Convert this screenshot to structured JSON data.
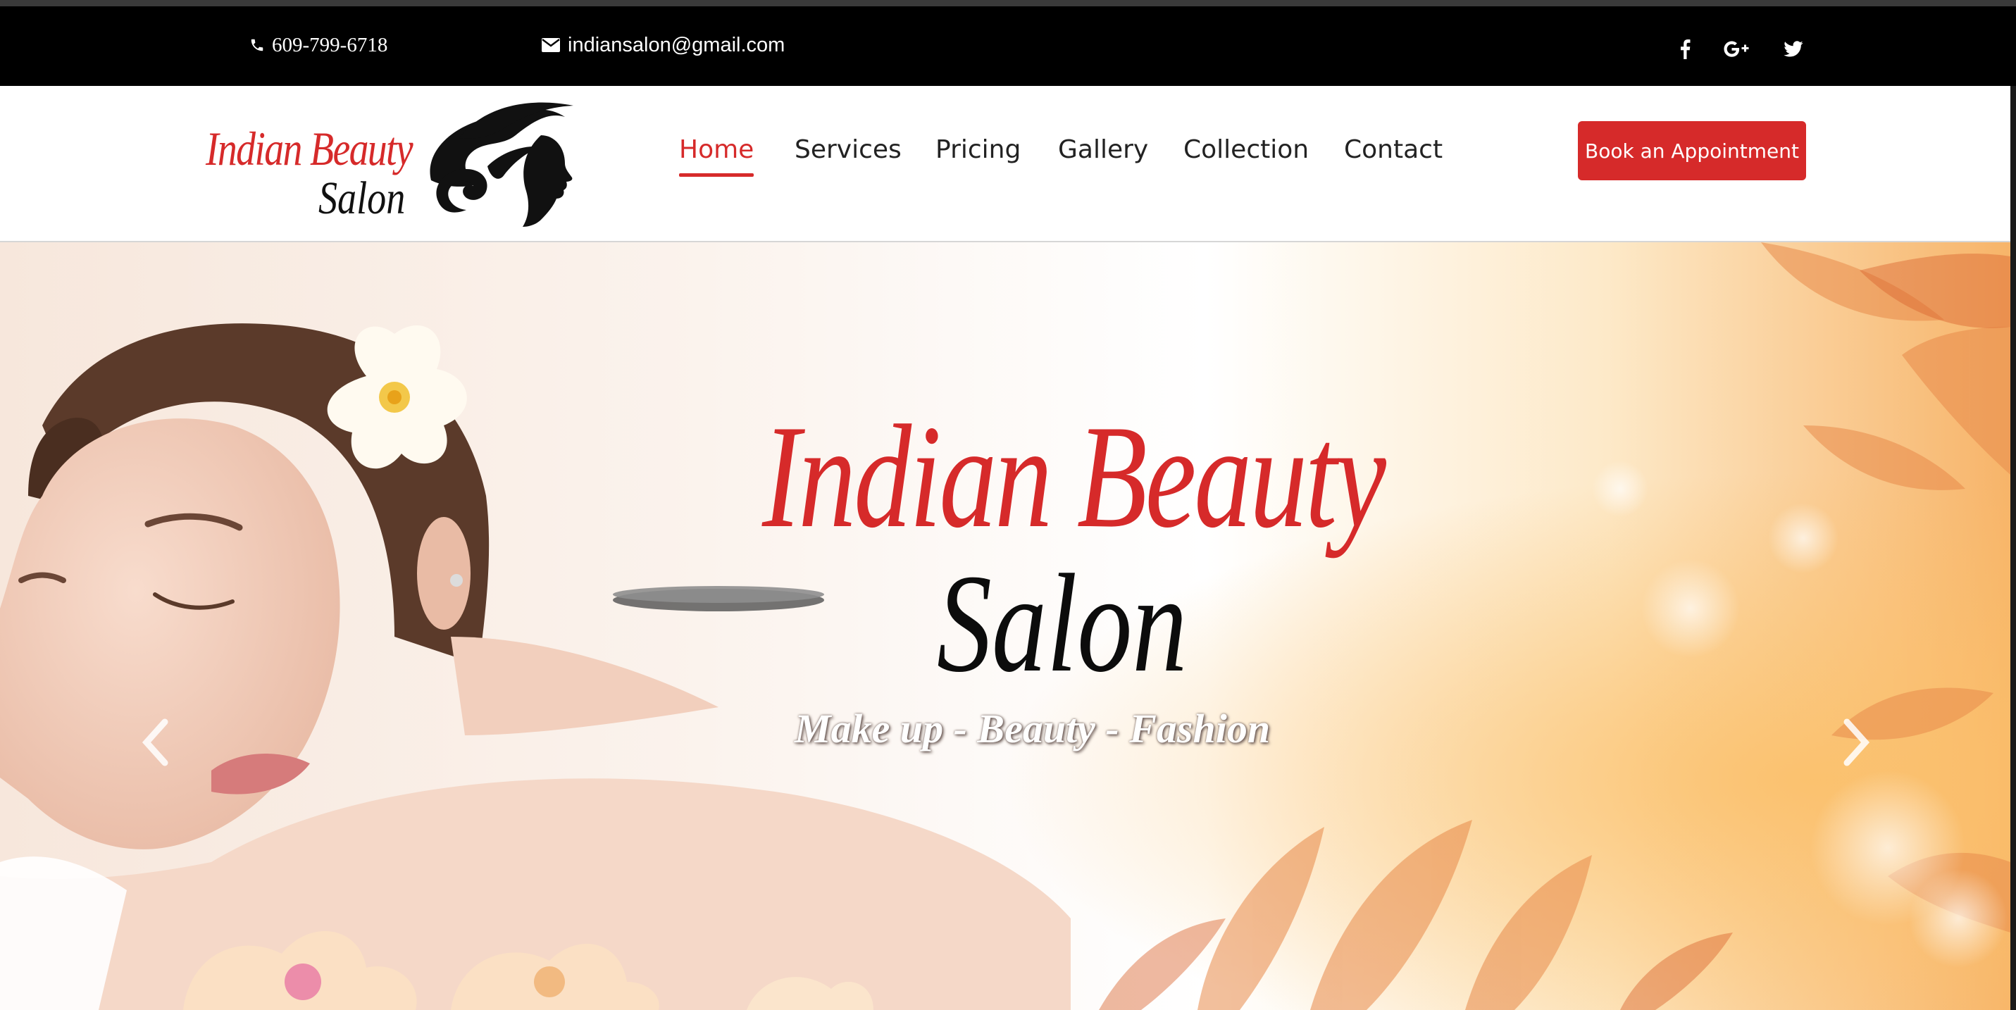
{
  "topbar": {
    "phone": "609-799-6718",
    "email": "indiansalon@gmail.com",
    "phone_icon": "phone-icon",
    "email_icon": "envelope-icon",
    "social": [
      {
        "name": "facebook-icon",
        "glyph": "f"
      },
      {
        "name": "google-plus-icon",
        "glyph": "G+"
      },
      {
        "name": "twitter-icon",
        "glyph": "twitter"
      }
    ]
  },
  "logo": {
    "line1": "Indian Beauty",
    "line2": "Salon"
  },
  "nav": {
    "items": [
      {
        "label": "Home",
        "active": true
      },
      {
        "label": "Services",
        "active": false
      },
      {
        "label": "Pricing",
        "active": false
      },
      {
        "label": "Gallery",
        "active": false
      },
      {
        "label": "Collection",
        "active": false
      },
      {
        "label": "Contact",
        "active": false
      }
    ]
  },
  "cta": {
    "label": "Book an Appointment"
  },
  "hero": {
    "title_line1": "Indian Beauty",
    "title_line2": "Salon",
    "tagline": "Make up - Beauty - Fashion",
    "prev_icon": "chevron-left-icon",
    "next_icon": "chevron-right-icon"
  },
  "colors": {
    "brand_red": "#d62a2a",
    "topbar_bg": "#000000",
    "header_bg": "#ffffff"
  }
}
